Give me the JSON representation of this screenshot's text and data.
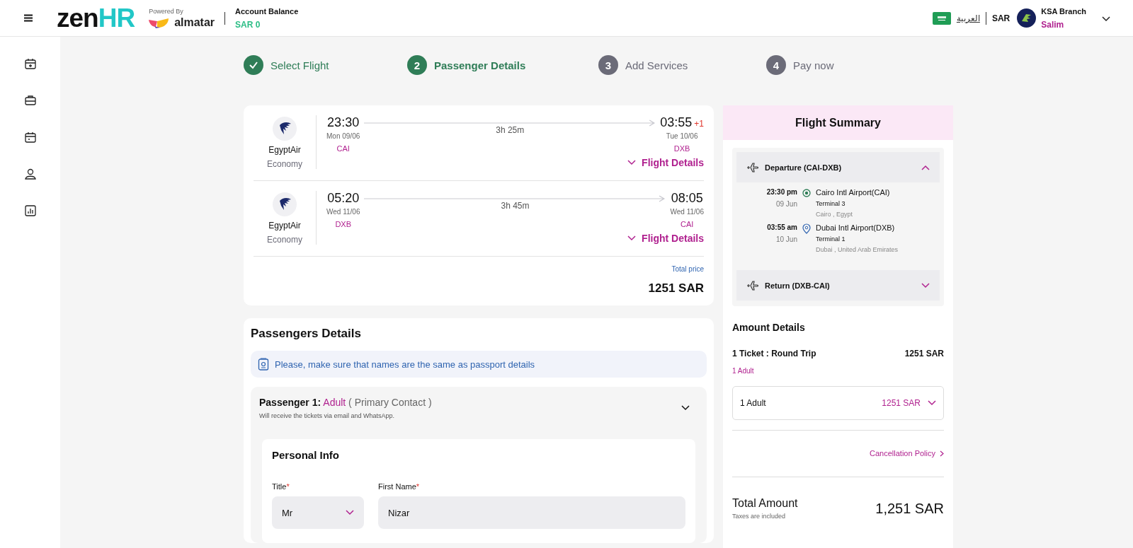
{
  "header": {
    "logo": "zen",
    "logo_accent": "HR",
    "powered_by": "Powered By",
    "partner": "almatar",
    "balance_label": "Account Balance",
    "balance_value": "SAR 0",
    "language": "العربية",
    "currency": "SAR",
    "branch": "KSA Branch",
    "user": "Salim"
  },
  "steps": [
    {
      "label": "Select Flight",
      "completed": true,
      "selected": false
    },
    {
      "number": "2",
      "label": "Passenger Details",
      "completed": false,
      "selected": true
    },
    {
      "number": "3",
      "label": "Add Services",
      "completed": false,
      "selected": false
    },
    {
      "number": "4",
      "label": "Pay now",
      "completed": false,
      "selected": false
    }
  ],
  "flights": [
    {
      "airline": "EgyptAir",
      "cabin": "Economy",
      "dep_time": "23:30",
      "dep_date": "Mon 09/06",
      "dep_code": "CAI",
      "duration": "3h 25m",
      "arr_time": "03:55",
      "day_offset": "+1",
      "arr_date": "Tue 10/06",
      "arr_code": "DXB",
      "details_link": "Flight Details"
    },
    {
      "airline": "EgyptAir",
      "cabin": "Economy",
      "dep_time": "05:20",
      "dep_date": "Wed 11/06",
      "dep_code": "DXB",
      "duration": "3h 45m",
      "arr_time": "08:05",
      "arr_date": "Wed 11/06",
      "arr_code": "CAI",
      "details_link": "Flight Details"
    }
  ],
  "total_price": {
    "label": "Total price",
    "value": "1251 SAR"
  },
  "passengers": {
    "title": "Passengers Details",
    "notice": "Please, make sure that names are the same as passport details",
    "passenger": {
      "label": "Passenger 1:",
      "type": "Adult",
      "role": "( Primary Contact )",
      "note": "Will receive the tickets via email and WhatsApp.",
      "expanded": true,
      "section_title": "Personal Info",
      "fields": [
        {
          "kind": "select",
          "label": "Title",
          "mark": "*",
          "value": "Mr"
        },
        {
          "kind": "text",
          "label": "First Name",
          "mark": "*",
          "value": "Nizar"
        }
      ]
    }
  },
  "summary": {
    "title": "Flight Summary",
    "legs": [
      {
        "title": "Departure (CAI-DXB)",
        "expanded": true,
        "stops": [
          {
            "kind": "origin",
            "time": "23:30 pm",
            "date": "09 Jun",
            "airport": "Cairo Intl Airport(CAI)",
            "terminal": "Terminal 3",
            "city": "Cairo , Egypt"
          },
          {
            "kind": "destination",
            "time": "03:55 am",
            "date": "10 Jun",
            "airport": "Dubai Intl Airport(DXB)",
            "terminal": "Terminal 1",
            "city": "Dubai , United Arab Emirates"
          }
        ]
      },
      {
        "title": "Return (DXB-CAI)",
        "expanded": false
      }
    ],
    "amount_title": "Amount Details",
    "ticket_label": "1 Ticket : Round Trip",
    "ticket_price": "1251 SAR",
    "travellers": "1 Adult",
    "breakdown": {
      "label": "1 Adult",
      "value": "1251 SAR",
      "expanded": false
    },
    "policy_link": "Cancellation Policy",
    "total_label": "Total Amount",
    "total_note": "Taxes are included",
    "total_value": "1,251 SAR"
  }
}
